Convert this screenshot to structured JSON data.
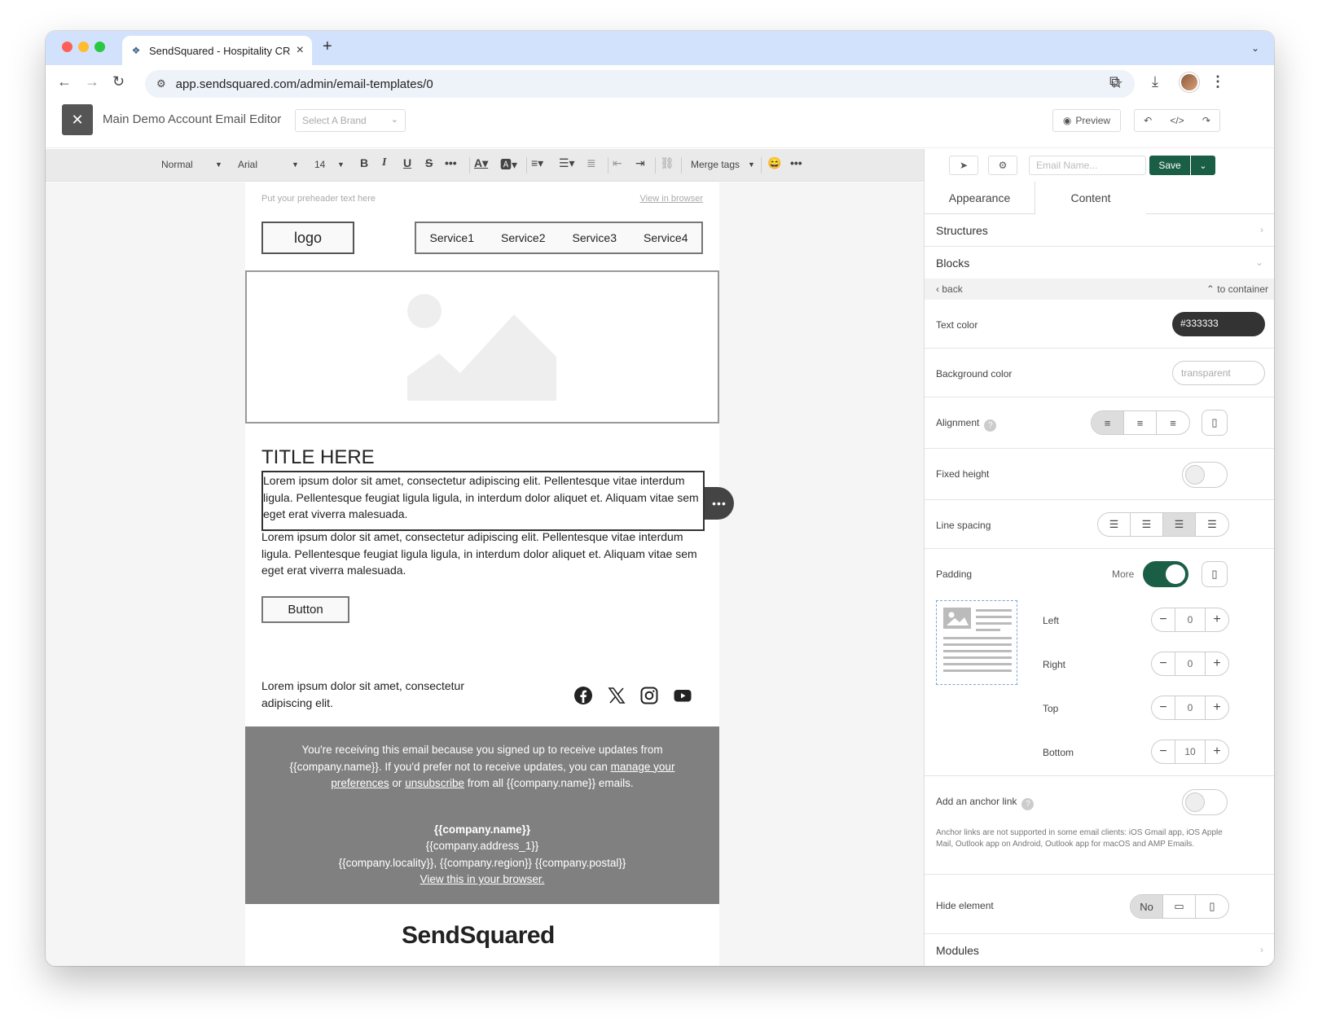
{
  "browser": {
    "tab_title": "SendSquared - Hospitality CR",
    "url": "app.sendsquared.com/admin/email-templates/0"
  },
  "app": {
    "title": "Main Demo Account Email Editor",
    "brand_placeholder": "Select A Brand",
    "preview_label": "Preview"
  },
  "format_bar": {
    "style": "Normal",
    "font": "Arial",
    "size": "14",
    "merge_tags": "Merge tags"
  },
  "email": {
    "preheader": "Put your preheader text here",
    "view_in_browser": "View in browser",
    "logo": "logo",
    "services": [
      "Service1",
      "Service2",
      "Service3",
      "Service4"
    ],
    "title": "TITLE HERE",
    "para1": "Lorem ipsum dolor sit amet, consectetur adipiscing elit. Pellentesque vitae interdum ligula. Pellentesque feugiat ligula ligula, in interdum dolor aliquet et. Aliquam vitae sem eget erat viverra malesuada.",
    "para2": "Lorem ipsum dolor sit amet, consectetur adipiscing elit. Pellentesque vitae interdum ligula. Pellentesque feugiat ligula ligula, in interdum dolor aliquet et. Aliquam vitae sem eget erat viverra malesuada.",
    "button": "Button",
    "footer_text": "Lorem ipsum dolor sit amet, consectetur adipiscing elit.",
    "notice_1": "You're receiving this email because you signed up to receive updates from {{company.name}}. If you'd prefer not to receive updates, you can",
    "notice_link1": "manage your preferences",
    "notice_or": "or",
    "notice_link2": "unsubscribe",
    "notice_2": "from all {{company.name}} emails.",
    "company_name": "{{company.name}}",
    "company_address": "{{company.address_1}}",
    "company_locality": "{{company.locality}}, {{company.region}} {{company.postal}}",
    "view_browser_link": "View this in your browser.",
    "brand_footer": "SendSquared"
  },
  "panel": {
    "email_name_placeholder": "Email Name...",
    "save": "Save",
    "tabs": [
      "Appearance",
      "Content"
    ],
    "structures": "Structures",
    "blocks": "Blocks",
    "back": "back",
    "to_container": "to container",
    "text_color_label": "Text color",
    "text_color_value": "#333333",
    "bg_color_label": "Background color",
    "bg_color_value": "transparent",
    "alignment_label": "Alignment",
    "fixed_height_label": "Fixed height",
    "line_spacing_label": "Line spacing",
    "padding_label": "Padding",
    "more_label": "More",
    "padding": [
      {
        "label": "Left",
        "value": "0"
      },
      {
        "label": "Right",
        "value": "0"
      },
      {
        "label": "Top",
        "value": "0"
      },
      {
        "label": "Bottom",
        "value": "10"
      }
    ],
    "anchor_label": "Add an anchor link",
    "anchor_note": "Anchor links are not supported in some email clients: iOS Gmail app, iOS Apple Mail, Outlook app on Android, Outlook app for macOS and AMP Emails.",
    "hide_label": "Hide element",
    "hide_no": "No",
    "modules": "Modules"
  },
  "colors": {
    "accent": "#1b5e46",
    "tabbar": "#d3e2fc",
    "footer_gray": "#808080"
  }
}
